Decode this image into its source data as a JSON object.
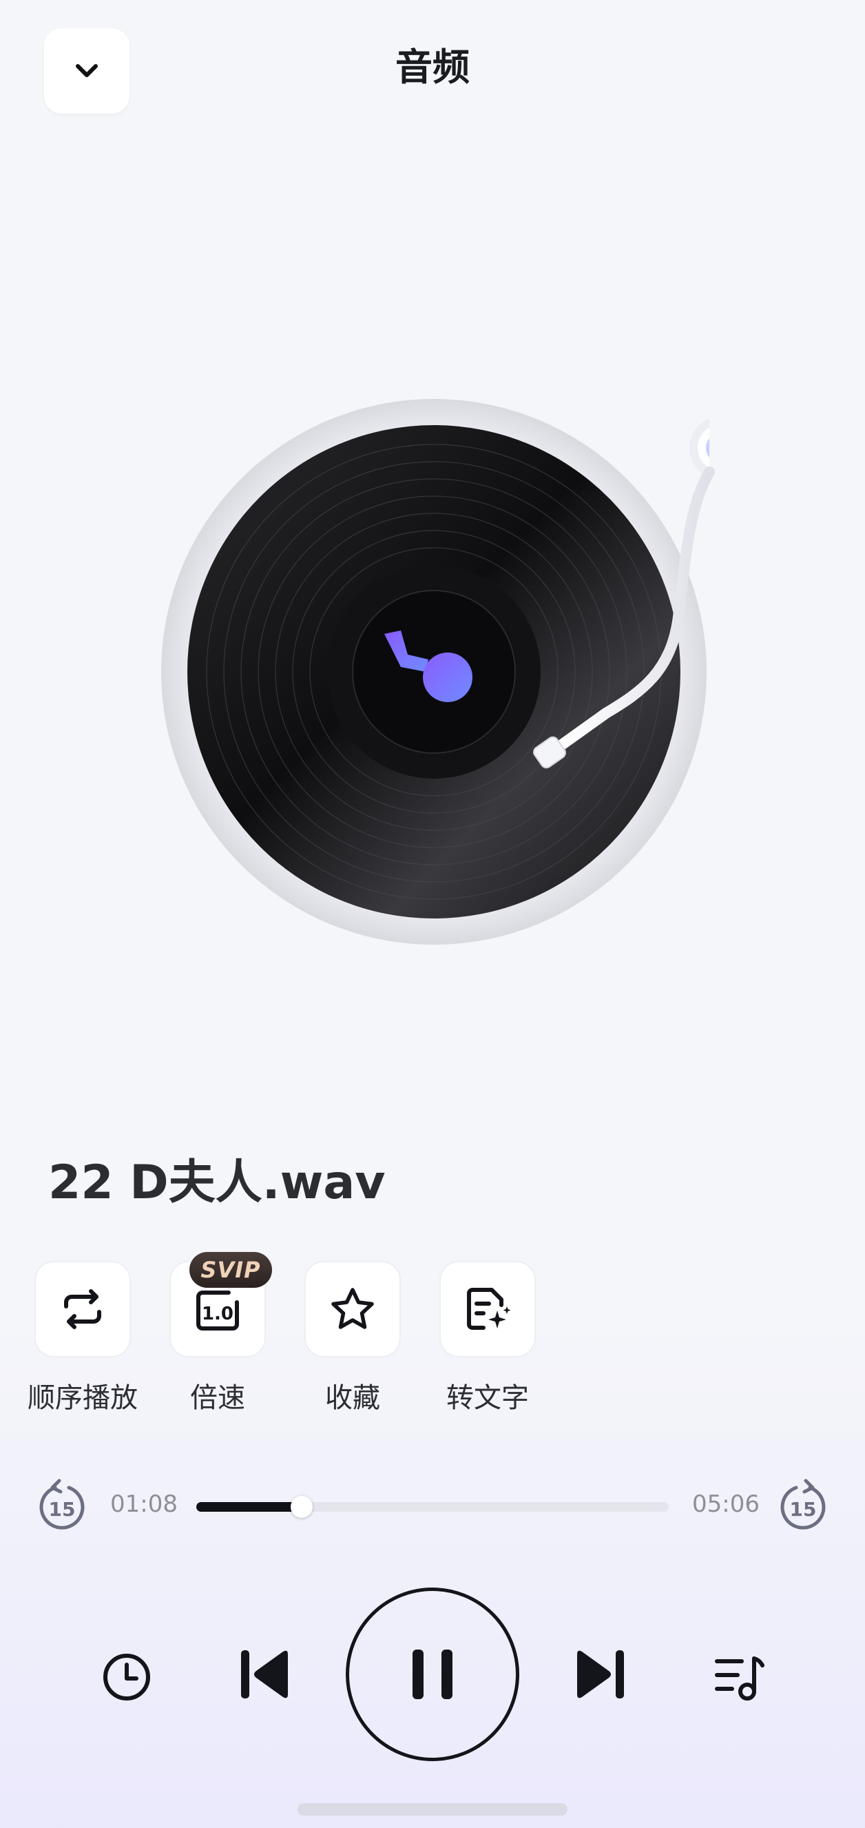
{
  "header": {
    "title": "音频"
  },
  "player": {
    "file_name": "22 D夫人.wav",
    "actions": [
      {
        "label": "顺序播放",
        "icon": "repeat-icon"
      },
      {
        "label": "倍速",
        "icon": "speed-icon",
        "icon_text": "1.0",
        "badge": "SVIP"
      },
      {
        "label": "收藏",
        "icon": "star-icon"
      },
      {
        "label": "转文字",
        "icon": "transcribe-icon"
      }
    ],
    "progress": {
      "current_time": "01:08",
      "total_time": "05:06",
      "fraction": 0.223,
      "rewind_label": "15",
      "forward_label": "15"
    },
    "controls": [
      "timer-icon",
      "previous-icon",
      "pause-icon",
      "next-icon",
      "playlist-icon"
    ]
  },
  "colors": {
    "accent": "#7b6dff",
    "progress": "#111218",
    "background": "#f5f6fa"
  }
}
